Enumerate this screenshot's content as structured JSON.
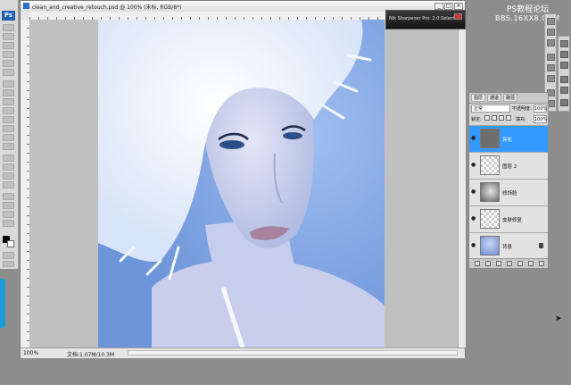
{
  "app": {
    "logo": "Ps"
  },
  "document": {
    "title": "clean_and_creative_retouch.psd @ 100% (未标, RGB/8*)",
    "zoom": "100%",
    "doc_info": "文档:1.07M/10.3M"
  },
  "plugin": {
    "label": "Nik Sharpener Pro: 2.0 Selective"
  },
  "watermark": {
    "line1": "PS教程论坛",
    "line2": "BBS.16XX8.COM"
  },
  "layers_panel": {
    "tabs": [
      "图层",
      "通道",
      "路径"
    ],
    "blend_mode": "正常",
    "opacity_label": "不透明度:",
    "opacity": "100%",
    "lock_label": "锁定:",
    "fill_label": "填充:",
    "fill": "100%",
    "layers": [
      {
        "name": "亮化",
        "thumb": "gray",
        "selected": true
      },
      {
        "name": "图层 2",
        "thumb": "checker",
        "selected": false
      },
      {
        "name": "修饰脸",
        "thumb": "face",
        "selected": false
      },
      {
        "name": "皮肤修复",
        "thumb": "checker",
        "selected": false
      },
      {
        "name": "背景",
        "thumb": "photo",
        "selected": false,
        "locked": true
      }
    ]
  },
  "icons": {
    "eye": "eye-icon",
    "lock": "lock-icon",
    "cursor": "arrow-cursor-icon"
  },
  "colors": {
    "selection": "#3399ff",
    "plugin_bar": "#1d1d1d",
    "photo_tone": "#a9c3ec"
  }
}
